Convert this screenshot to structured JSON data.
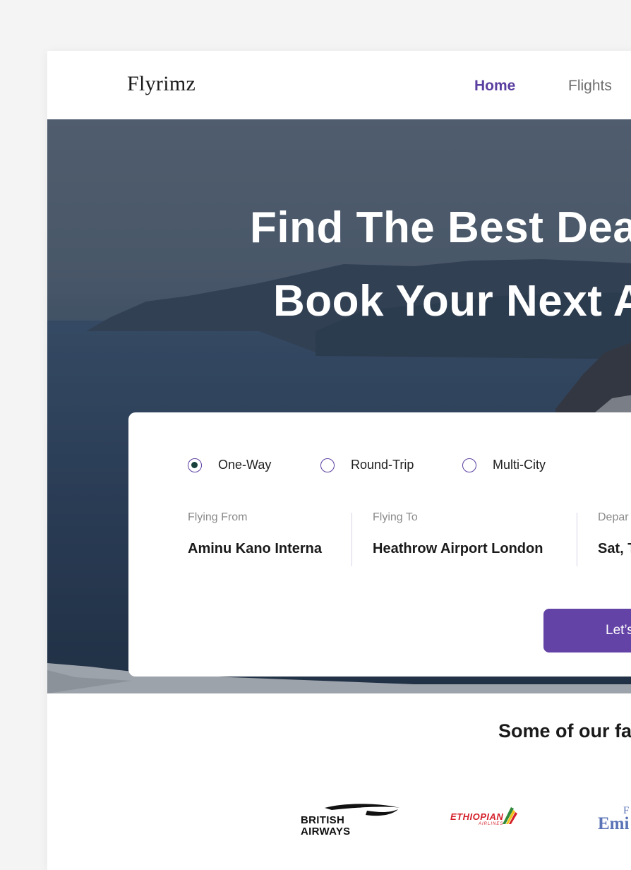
{
  "header": {
    "logo": "Flyrimz",
    "nav": [
      {
        "label": "Home",
        "active": true
      },
      {
        "label": "Flights",
        "active": false
      }
    ]
  },
  "hero": {
    "headline_line1": "Find The Best Dea",
    "headline_line2": "Book Your Next A"
  },
  "search": {
    "trip_types": [
      {
        "label": "One-Way",
        "selected": true
      },
      {
        "label": "Round-Trip",
        "selected": false
      },
      {
        "label": "Multi-City",
        "selected": false
      }
    ],
    "fields": [
      {
        "label": "Flying From",
        "value": "Aminu Kano Interna"
      },
      {
        "label": "Flying To",
        "value": "Heathrow Airport London"
      },
      {
        "label": "Depar",
        "value": "Sat, T"
      }
    ],
    "cta_label": "Let’s"
  },
  "partners": {
    "title": "Some of our fa",
    "logos": {
      "british_airways": [
        "BRITISH",
        "AIRWAYS"
      ],
      "ethiopian": [
        "ETHIOPIAN",
        "AIRLINES"
      ],
      "emirates": [
        "F",
        "Emi"
      ]
    }
  },
  "colors": {
    "accent": "#6443a6",
    "nav_active": "#5a3ea0",
    "radio_dot": "#17413a"
  }
}
